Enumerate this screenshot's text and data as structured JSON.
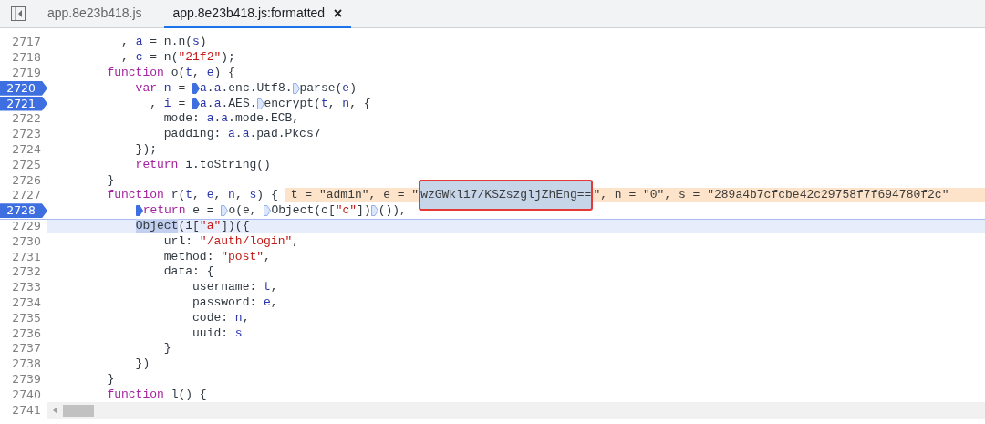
{
  "tabs": [
    {
      "label": "app.8e23b418.js",
      "selected": false,
      "closable": false
    },
    {
      "label": "app.8e23b418.js:formatted",
      "selected": true,
      "closable": true
    }
  ],
  "lines": [
    {
      "number": "2717",
      "breakpoint": false,
      "current": false,
      "tokens": [
        {
          "kind": "plain",
          "text": "          , "
        },
        {
          "kind": "variable",
          "text": "a"
        },
        {
          "kind": "plain",
          "text": " = n.n("
        },
        {
          "kind": "variable",
          "text": "s"
        },
        {
          "kind": "plain",
          "text": ")"
        }
      ]
    },
    {
      "number": "2718",
      "breakpoint": false,
      "current": false,
      "tokens": [
        {
          "kind": "plain",
          "text": "          , "
        },
        {
          "kind": "variable",
          "text": "c"
        },
        {
          "kind": "plain",
          "text": " = n("
        },
        {
          "kind": "string",
          "text": "\"21f2\""
        },
        {
          "kind": "plain",
          "text": ");"
        }
      ]
    },
    {
      "number": "2719",
      "breakpoint": false,
      "current": false,
      "tokens": [
        {
          "kind": "keyword",
          "text": "        function"
        },
        {
          "kind": "plain",
          "text": " o("
        },
        {
          "kind": "variable",
          "text": "t"
        },
        {
          "kind": "plain",
          "text": ", "
        },
        {
          "kind": "variable",
          "text": "e"
        },
        {
          "kind": "plain",
          "text": ") {"
        }
      ]
    },
    {
      "number": "2720",
      "breakpoint": true,
      "current": false,
      "tokens": [
        {
          "kind": "keyword",
          "text": "            var"
        },
        {
          "kind": "variable",
          "text": " n"
        },
        {
          "kind": "plain",
          "text": " = "
        },
        {
          "kind": "variable",
          "text": "a",
          "marker": true,
          "active": true
        },
        {
          "kind": "plain",
          "text": "."
        },
        {
          "kind": "variable",
          "text": "a"
        },
        {
          "kind": "plain",
          "text": ".enc.Utf8."
        },
        {
          "kind": "plain",
          "text": "parse(",
          "marker": true,
          "active": false
        },
        {
          "kind": "variable",
          "text": "e"
        },
        {
          "kind": "plain",
          "text": ")"
        }
      ]
    },
    {
      "number": "2721",
      "breakpoint": true,
      "current": false,
      "tokens": [
        {
          "kind": "plain",
          "text": "              , "
        },
        {
          "kind": "variable",
          "text": "i"
        },
        {
          "kind": "plain",
          "text": " = "
        },
        {
          "kind": "variable",
          "text": "a",
          "marker": true,
          "active": true
        },
        {
          "kind": "plain",
          "text": "."
        },
        {
          "kind": "variable",
          "text": "a"
        },
        {
          "kind": "plain",
          "text": ".AES."
        },
        {
          "kind": "plain",
          "text": "encrypt(",
          "marker": true,
          "active": false
        },
        {
          "kind": "variable",
          "text": "t"
        },
        {
          "kind": "plain",
          "text": ", "
        },
        {
          "kind": "variable",
          "text": "n"
        },
        {
          "kind": "plain",
          "text": ", {"
        }
      ]
    },
    {
      "number": "2722",
      "breakpoint": false,
      "current": false,
      "tokens": [
        {
          "kind": "plain",
          "text": "                mode: "
        },
        {
          "kind": "variable",
          "text": "a"
        },
        {
          "kind": "plain",
          "text": "."
        },
        {
          "kind": "variable",
          "text": "a"
        },
        {
          "kind": "plain",
          "text": ".mode.ECB,"
        }
      ]
    },
    {
      "number": "2723",
      "breakpoint": false,
      "current": false,
      "tokens": [
        {
          "kind": "plain",
          "text": "                padding: "
        },
        {
          "kind": "variable",
          "text": "a"
        },
        {
          "kind": "plain",
          "text": "."
        },
        {
          "kind": "variable",
          "text": "a"
        },
        {
          "kind": "plain",
          "text": ".pad.Pkcs7"
        }
      ]
    },
    {
      "number": "2724",
      "breakpoint": false,
      "current": false,
      "tokens": [
        {
          "kind": "plain",
          "text": "            });"
        }
      ]
    },
    {
      "number": "2725",
      "breakpoint": false,
      "current": false,
      "tokens": [
        {
          "kind": "keyword",
          "text": "            return"
        },
        {
          "kind": "plain",
          "text": " i.toString()"
        }
      ]
    },
    {
      "number": "2726",
      "breakpoint": false,
      "current": false,
      "tokens": [
        {
          "kind": "plain",
          "text": "        }"
        }
      ]
    },
    {
      "number": "2727",
      "breakpoint": false,
      "current": false,
      "tokens": [
        {
          "kind": "keyword",
          "text": "        function"
        },
        {
          "kind": "plain",
          "text": " r("
        },
        {
          "kind": "variable",
          "text": "t"
        },
        {
          "kind": "plain",
          "text": ", "
        },
        {
          "kind": "variable",
          "text": "e"
        },
        {
          "kind": "plain",
          "text": ", "
        },
        {
          "kind": "variable",
          "text": "n"
        },
        {
          "kind": "plain",
          "text": ", "
        },
        {
          "kind": "variable",
          "text": "s"
        },
        {
          "kind": "plain",
          "text": ") {"
        }
      ],
      "inline_values": [
        {
          "text": "t = \"admin\", e = \"",
          "selected": false,
          "boxed": false
        },
        {
          "text": "wzGWkli7/KSZszgljZhEng==",
          "selected": true,
          "boxed": true
        },
        {
          "text": "\", n = \"0\", s = \"289a4b7cfcbe42c29758f7f694780f2c\"",
          "selected": false,
          "boxed": false
        }
      ]
    },
    {
      "number": "2728",
      "breakpoint": true,
      "current": false,
      "tokens": [
        {
          "kind": "keyword",
          "text": "            return",
          "marker": true,
          "active": true
        },
        {
          "kind": "plain",
          "text": " e = "
        },
        {
          "kind": "plain",
          "text": "o(e, ",
          "marker": true,
          "active": false
        },
        {
          "kind": "plain",
          "text": "Object(c[",
          "marker": true,
          "active": false
        },
        {
          "kind": "string",
          "text": "\"c\""
        },
        {
          "kind": "plain",
          "text": "])"
        },
        {
          "kind": "plain",
          "text": "()),",
          "marker": true,
          "active": false
        }
      ]
    },
    {
      "number": "2729",
      "breakpoint": false,
      "current": true,
      "tokens": [
        {
          "kind": "selection",
          "text": "            Object"
        },
        {
          "kind": "plain",
          "text": "(i["
        },
        {
          "kind": "string",
          "text": "\"a\""
        },
        {
          "kind": "plain",
          "text": "])({"
        }
      ]
    },
    {
      "number": "2730",
      "breakpoint": false,
      "current": false,
      "tokens": [
        {
          "kind": "plain",
          "text": "                url: "
        },
        {
          "kind": "string",
          "text": "\"/auth/login\""
        },
        {
          "kind": "plain",
          "text": ","
        }
      ]
    },
    {
      "number": "2731",
      "breakpoint": false,
      "current": false,
      "tokens": [
        {
          "kind": "plain",
          "text": "                method: "
        },
        {
          "kind": "string",
          "text": "\"post\""
        },
        {
          "kind": "plain",
          "text": ","
        }
      ]
    },
    {
      "number": "2732",
      "breakpoint": false,
      "current": false,
      "tokens": [
        {
          "kind": "plain",
          "text": "                data: {"
        }
      ]
    },
    {
      "number": "2733",
      "breakpoint": false,
      "current": false,
      "tokens": [
        {
          "kind": "plain",
          "text": "                    username: "
        },
        {
          "kind": "variable",
          "text": "t"
        },
        {
          "kind": "plain",
          "text": ","
        }
      ]
    },
    {
      "number": "2734",
      "breakpoint": false,
      "current": false,
      "tokens": [
        {
          "kind": "plain",
          "text": "                    password: "
        },
        {
          "kind": "variable",
          "text": "e"
        },
        {
          "kind": "plain",
          "text": ","
        }
      ]
    },
    {
      "number": "2735",
      "breakpoint": false,
      "current": false,
      "tokens": [
        {
          "kind": "plain",
          "text": "                    code: "
        },
        {
          "kind": "variable",
          "text": "n"
        },
        {
          "kind": "plain",
          "text": ","
        }
      ]
    },
    {
      "number": "2736",
      "breakpoint": false,
      "current": false,
      "tokens": [
        {
          "kind": "plain",
          "text": "                    uuid: "
        },
        {
          "kind": "variable",
          "text": "s"
        }
      ]
    },
    {
      "number": "2737",
      "breakpoint": false,
      "current": false,
      "tokens": [
        {
          "kind": "plain",
          "text": "                }"
        }
      ]
    },
    {
      "number": "2738",
      "breakpoint": false,
      "current": false,
      "tokens": [
        {
          "kind": "plain",
          "text": "            })"
        }
      ]
    },
    {
      "number": "2739",
      "breakpoint": false,
      "current": false,
      "tokens": [
        {
          "kind": "plain",
          "text": "        }"
        }
      ]
    },
    {
      "number": "2740",
      "breakpoint": false,
      "current": false,
      "tokens": [
        {
          "kind": "keyword",
          "text": "        function"
        },
        {
          "kind": "plain",
          "text": " l() {"
        }
      ]
    },
    {
      "number": "2741",
      "breakpoint": false,
      "current": false
    }
  ]
}
